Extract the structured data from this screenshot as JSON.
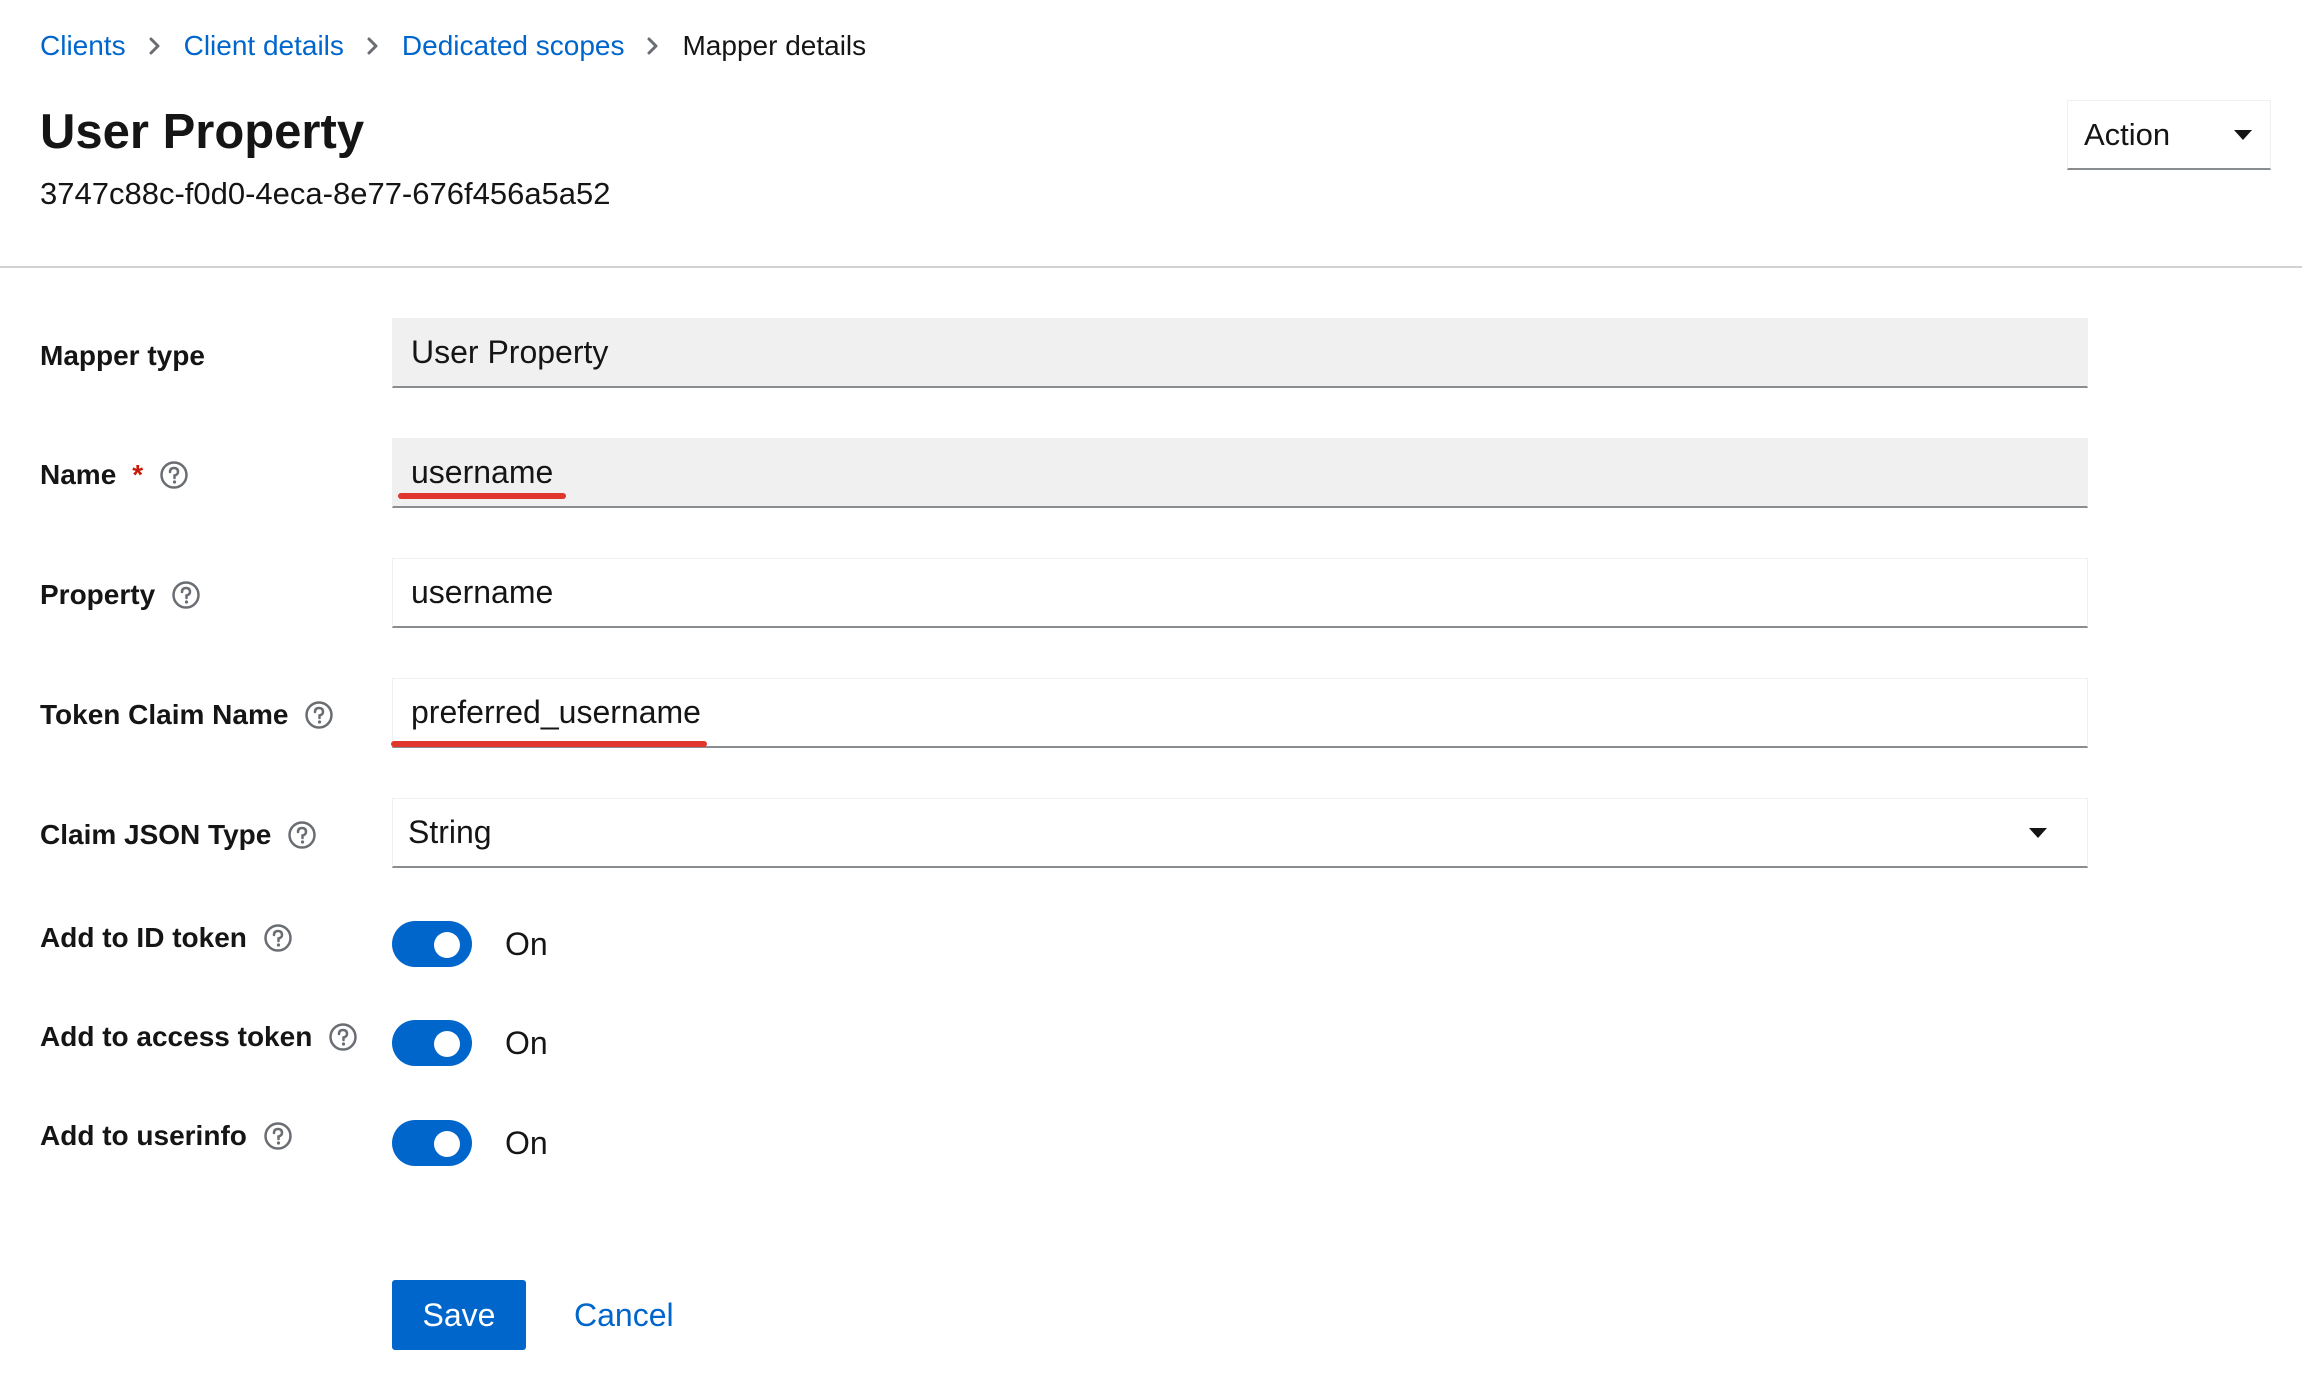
{
  "breadcrumb": {
    "items": [
      {
        "label": "Clients"
      },
      {
        "label": "Client details"
      },
      {
        "label": "Dedicated scopes"
      }
    ],
    "current": "Mapper details"
  },
  "header": {
    "title": "User Property",
    "subtitle": "3747c88c-f0d0-4eca-8e77-676f456a5a52",
    "action_label": "Action"
  },
  "form": {
    "mapper_type": {
      "label": "Mapper type",
      "value": "User Property"
    },
    "name": {
      "label": "Name",
      "required_mark": "*",
      "value": "username"
    },
    "property": {
      "label": "Property",
      "value": "username"
    },
    "token_claim_name": {
      "label": "Token Claim Name",
      "value": "preferred_username"
    },
    "claim_json_type": {
      "label": "Claim JSON Type",
      "value": "String"
    },
    "add_to_id_token": {
      "label": "Add to ID token",
      "state": "On"
    },
    "add_to_access_token": {
      "label": "Add to access token",
      "state": "On"
    },
    "add_to_userinfo": {
      "label": "Add to userinfo",
      "state": "On"
    }
  },
  "footer": {
    "save_label": "Save",
    "cancel_label": "Cancel"
  },
  "colors": {
    "link": "#0066cc",
    "primary": "#0066cc",
    "annotation": "#e0362c",
    "required": "#c9190b"
  }
}
